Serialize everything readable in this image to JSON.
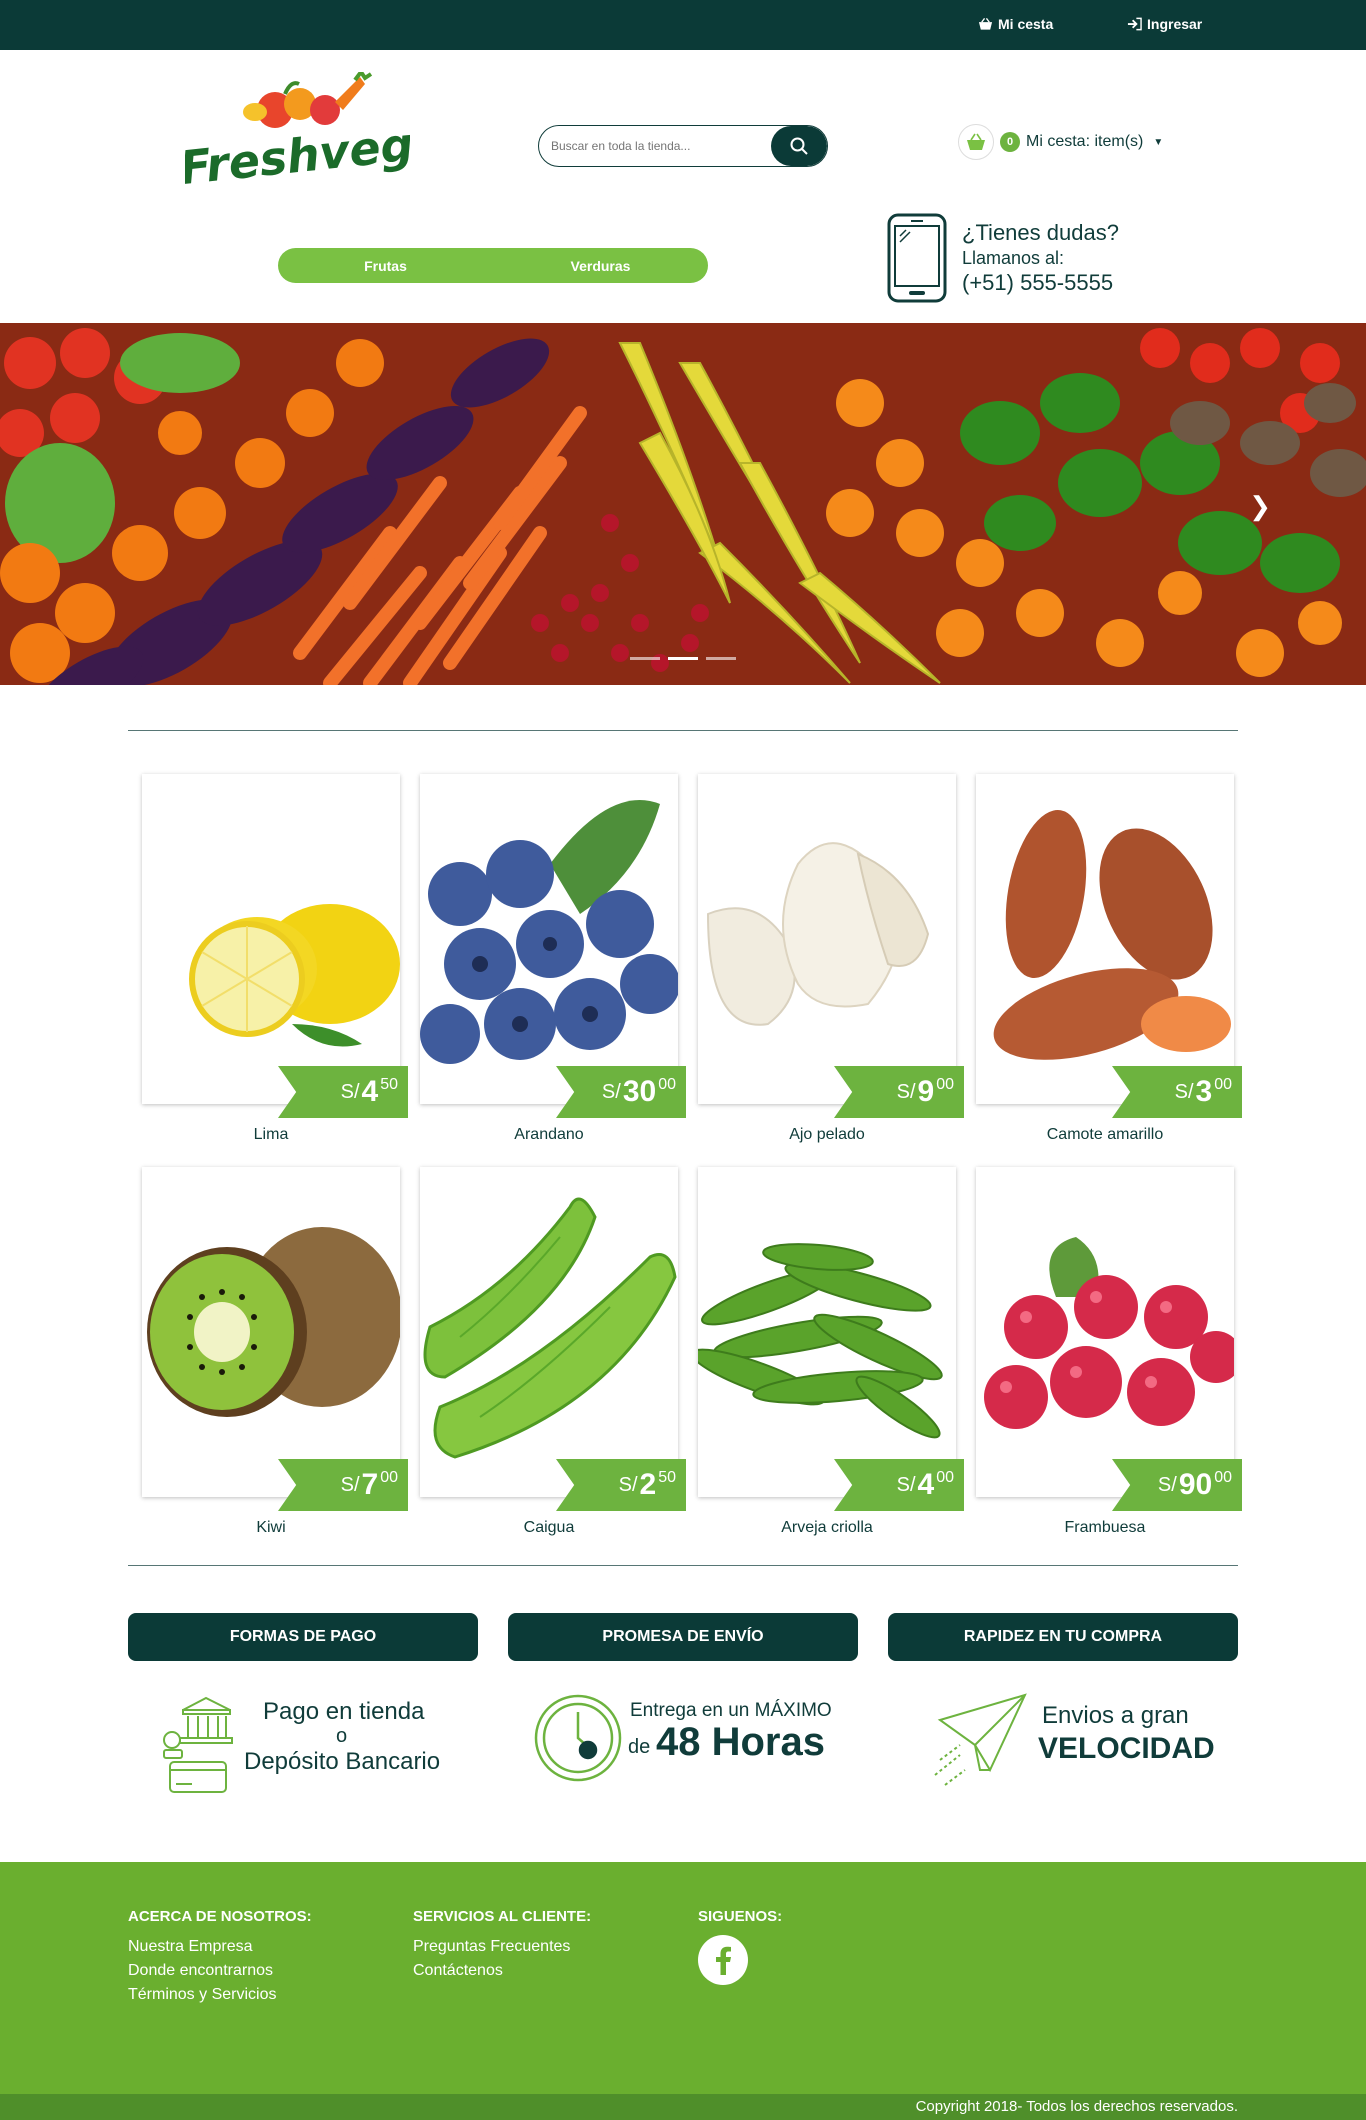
{
  "topbar": {
    "cart_label": "Mi cesta",
    "login_label": "Ingresar"
  },
  "header": {
    "logo_text": "Freshveg",
    "search_placeholder": "Buscar en toda la tienda...",
    "cart_count": "0",
    "cart_text": "Mi cesta: item(s)"
  },
  "nav": {
    "items": [
      "Frutas",
      "Verduras"
    ]
  },
  "help": {
    "question": "¿Tienes dudas?",
    "line": "Llamanos al:",
    "phone": "(+51) 555-5555"
  },
  "products": [
    {
      "name": "Lima",
      "currency": "S/",
      "int": "4",
      "dec": "50"
    },
    {
      "name": "Arandano",
      "currency": "S/",
      "int": "30",
      "dec": "00"
    },
    {
      "name": "Ajo pelado",
      "currency": "S/",
      "int": "9",
      "dec": "00"
    },
    {
      "name": "Camote amarillo",
      "currency": "S/",
      "int": "3",
      "dec": "00"
    },
    {
      "name": "Kiwi",
      "currency": "S/",
      "int": "7",
      "dec": "00"
    },
    {
      "name": "Caigua",
      "currency": "S/",
      "int": "2",
      "dec": "50"
    },
    {
      "name": "Arveja criolla",
      "currency": "S/",
      "int": "4",
      "dec": "00"
    },
    {
      "name": "Frambuesa",
      "currency": "S/",
      "int": "90",
      "dec": "00"
    }
  ],
  "features": {
    "buttons": [
      "FORMAS DE PAGO",
      "PROMESA DE ENVÍO",
      "RAPIDEZ EN TU COMPRA"
    ],
    "pago": {
      "l1": "Pago en tienda",
      "l2": "o",
      "l3": "Depósito Bancario"
    },
    "envio": {
      "l1": "Entrega en un MÁXIMO",
      "de": "de",
      "l2": "48 Horas"
    },
    "rapidez": {
      "l1": "Envios a gran",
      "l2": "VELOCIDAD"
    }
  },
  "footer": {
    "about": {
      "title": "ACERCA DE NOSOTROS:",
      "links": [
        "Nuestra Empresa",
        "Donde encontrarnos",
        "Términos y Servicios"
      ]
    },
    "services": {
      "title": "SERVICIOS AL CLIENTE:",
      "links": [
        "Preguntas Frecuentes",
        "Contáctenos"
      ]
    },
    "social": {
      "title": "SIGUENOS:"
    },
    "copyright": "Copyright 2018- Todos los derechos reservados."
  },
  "colors": {
    "dark": "#0b3a37",
    "green": "#6db33f",
    "footer": "#6aaf2f"
  }
}
